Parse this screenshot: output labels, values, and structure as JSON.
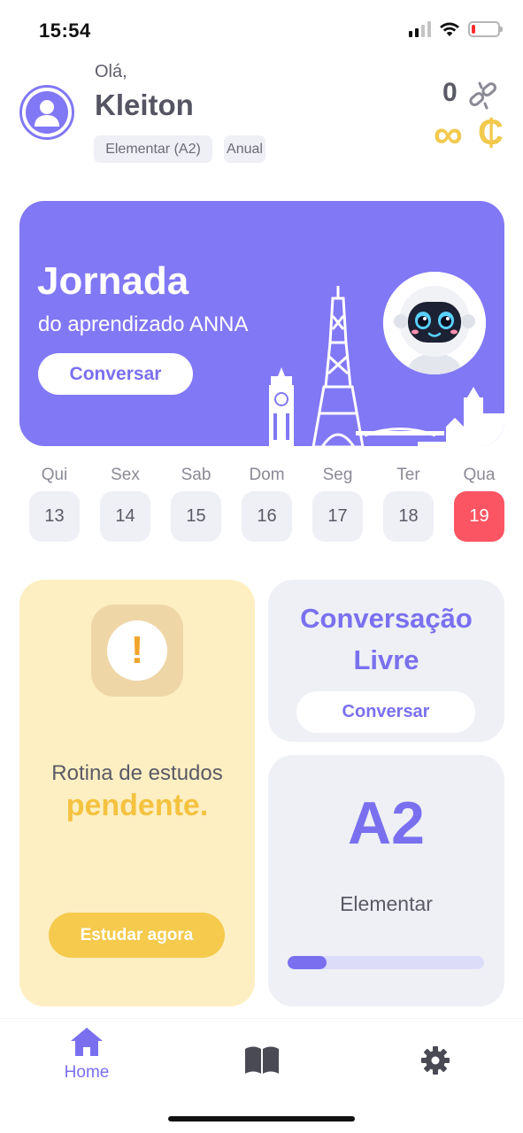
{
  "status_bar": {
    "time": "15:54",
    "battery_level": 0.15,
    "colors": {
      "battery_low": "#ff2d2d"
    }
  },
  "header": {
    "greeting": "Olá,",
    "user_name": "Kleiton",
    "badges": {
      "level": "Elementar (A2)",
      "plan": "Anual"
    },
    "streak_count": "0",
    "coins_symbol": "∞",
    "coin_icon_glyph": "₵",
    "icons": [
      "avatar-icon",
      "broken-link-icon",
      "coin-icon"
    ]
  },
  "banner": {
    "title": "Jornada",
    "subtitle": "do aprendizado ANNA",
    "button_label": "Conversar",
    "illustrations": [
      "eiffel-tower-icon",
      "big-ben-icon",
      "robot-avatar-icon"
    ]
  },
  "week": {
    "days": [
      {
        "name": "Qui",
        "number": "13",
        "active": false
      },
      {
        "name": "Sex",
        "number": "14",
        "active": false
      },
      {
        "name": "Sab",
        "number": "15",
        "active": false
      },
      {
        "name": "Dom",
        "number": "16",
        "active": false
      },
      {
        "name": "Seg",
        "number": "17",
        "active": false
      },
      {
        "name": "Ter",
        "number": "18",
        "active": false
      },
      {
        "name": "Qua",
        "number": "19",
        "active": true
      }
    ]
  },
  "routine_card": {
    "text": "Rotina de estudos",
    "status": "pendente.",
    "button_label": "Estudar agora",
    "icon": "exclamation-icon"
  },
  "free_conversation_card": {
    "title": "Conversação Livre",
    "button_label": "Conversar"
  },
  "level_card": {
    "code": "A2",
    "name": "Elementar",
    "progress": 0.2
  },
  "bottom_nav": {
    "items": [
      {
        "label": "Home",
        "icon": "home-icon",
        "active": true
      },
      {
        "label": "",
        "icon": "book-icon",
        "active": false
      },
      {
        "label": "",
        "icon": "gear-icon",
        "active": false
      }
    ]
  },
  "colors": {
    "primary": "#7a70ef",
    "banner": "#8178f5",
    "accent_yellow": "#f5c240",
    "today": "#fb5563",
    "card_bg": "#eef0f5",
    "routine_bg": "#fdefc2"
  }
}
